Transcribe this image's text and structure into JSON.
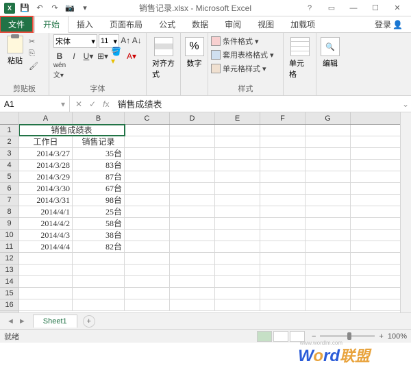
{
  "title": "销售记录.xlsx - Microsoft Excel",
  "tabs": {
    "file": "文件",
    "home": "开始",
    "insert": "插入",
    "layout": "页面布局",
    "formula": "公式",
    "data": "数据",
    "review": "审阅",
    "view": "视图",
    "addin": "加载项",
    "login": "登录"
  },
  "ribbon": {
    "clipboard": {
      "paste": "粘贴",
      "label": "剪贴板"
    },
    "font": {
      "name": "宋体",
      "size": "11",
      "label": "字体"
    },
    "align": {
      "btn": "对齐方式",
      "label": ""
    },
    "number": {
      "btn": "数字",
      "label": ""
    },
    "styles": {
      "cond": "条件格式",
      "table": "套用表格格式",
      "cell": "单元格样式",
      "label": "样式"
    },
    "cells": {
      "btn": "单元格",
      "label": ""
    },
    "edit": {
      "btn": "编辑",
      "label": ""
    }
  },
  "namebox": "A1",
  "formula": "销售成绩表",
  "cols": [
    "A",
    "B",
    "C",
    "D",
    "E",
    "F",
    "G"
  ],
  "rows": [
    "1",
    "2",
    "3",
    "4",
    "5",
    "6",
    "7",
    "8",
    "9",
    "10",
    "11",
    "12",
    "13",
    "14",
    "15",
    "16"
  ],
  "chart_data": {
    "type": "table",
    "title": "销售成绩表",
    "headers": [
      "工作日",
      "销售记录"
    ],
    "data": [
      [
        "2014/3/27",
        "35台"
      ],
      [
        "2014/3/28",
        "83台"
      ],
      [
        "2014/3/29",
        "87台"
      ],
      [
        "2014/3/30",
        "67台"
      ],
      [
        "2014/3/31",
        "98台"
      ],
      [
        "2014/4/1",
        "25台"
      ],
      [
        "2014/4/2",
        "58台"
      ],
      [
        "2014/4/3",
        "38台"
      ],
      [
        "2014/4/4",
        "82台"
      ]
    ]
  },
  "sheet": "Sheet1",
  "status": "就绪",
  "zoom": "100%",
  "watermark": {
    "url": "www.wordlm.com"
  }
}
